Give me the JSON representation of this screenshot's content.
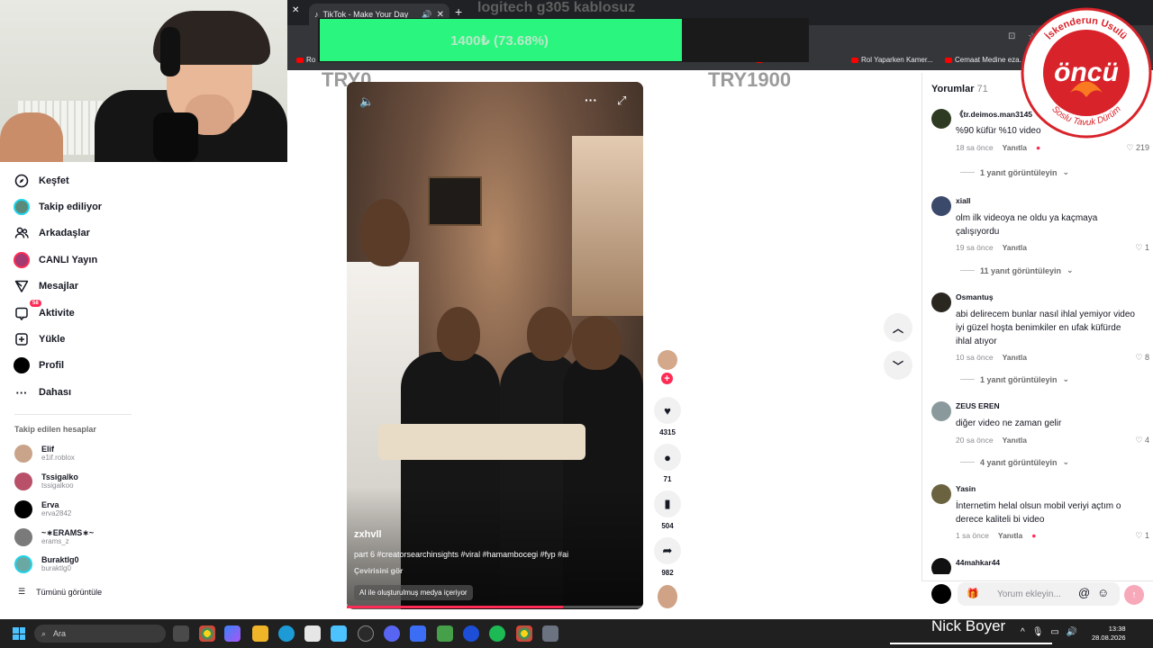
{
  "browser": {
    "tab_title": "TikTok - Make Your Day",
    "tab_close": "✕",
    "window_close": "✕",
    "new_tab": "+",
    "bookmarks": [
      {
        "label": "Ro"
      },
      {
        "label": "s Not Dr..."
      },
      {
        "label": "Rol Yaparken Kamer..."
      },
      {
        "label": "Cemaat Medine eza..."
      }
    ]
  },
  "overlay": {
    "title": "logitech g305 kablosuz",
    "goal_text": "1400₺ (73.68%)",
    "progress_fraction": 0.7368,
    "min_label": "TRY0",
    "max_label": "TRY1900",
    "fill_color": "#2af57e"
  },
  "sidebar": {
    "items": [
      {
        "label": "Keşfet",
        "icon": "compass-icon",
        "glyph": "◎"
      },
      {
        "label": "Takip ediliyor",
        "icon": "following-avatar-icon",
        "glyph": ""
      },
      {
        "label": "Arkadaşlar",
        "icon": "friends-icon",
        "glyph": "👥"
      },
      {
        "label": "CANLI Yayın",
        "icon": "live-icon",
        "glyph": ""
      },
      {
        "label": "Mesajlar",
        "icon": "send-icon",
        "glyph": "▽"
      },
      {
        "label": "Aktivite",
        "icon": "activity-icon",
        "glyph": "▢",
        "badge": "58"
      },
      {
        "label": "Yükle",
        "icon": "upload-icon",
        "glyph": "⊞"
      },
      {
        "label": "Profil",
        "icon": "profile-icon",
        "glyph": ""
      },
      {
        "label": "Dahası",
        "icon": "more-icon",
        "glyph": "···"
      }
    ],
    "following_header": "Takip edilen hesaplar",
    "accounts": [
      {
        "name": "Elif",
        "handle": "e1if.roblox",
        "color": "#c9a48a"
      },
      {
        "name": "Tssigalko",
        "handle": "tssigalkoo",
        "color": "#b8506a"
      },
      {
        "name": "Erva",
        "handle": "erva2842",
        "color": "#000000"
      },
      {
        "name": "~∗ERAMS∗~",
        "handle": "erams_z",
        "color": "#7a7a7a"
      },
      {
        "name": "Buraktlg0",
        "handle": "buraktlg0",
        "color": "#6aa8a4"
      }
    ],
    "see_all": "Tümünü görüntüle"
  },
  "video": {
    "author": "zxhvll",
    "description": "part 6 #creatorsearchinsights #viral #hamambocegi #fyp #ai",
    "translate": "Çevirisini gör",
    "ai_label": "AI ile oluşturulmuş medya içeriyor",
    "progress_fraction": 0.73
  },
  "actions": {
    "likes": "4315",
    "comments": "71",
    "saves": "504",
    "shares": "982"
  },
  "comments_panel": {
    "header": "Yorumlar",
    "count": "71",
    "input_placeholder": "Yorum ekleyin...",
    "comments": [
      {
        "user": "《tr.deimos.man3145",
        "text": "%90 küfür %10 video",
        "time": "18 sa önce",
        "reply": "Yanıtla",
        "likes": "219",
        "replies": "1 yanıt görüntüleyin",
        "avatar_color": "#2e3a22"
      },
      {
        "user": "xiall",
        "text": "olm ilk videoya ne oldu ya kaçmaya çalışıyordu",
        "time": "19 sa önce",
        "reply": "Yanıtla",
        "likes": "1",
        "replies": "11 yanıt görüntüleyin",
        "avatar_color": "#3b4a6b"
      },
      {
        "user": "Osmantuş",
        "text": "abi delirecem bunlar nasıl ihlal yemiyor video iyi güzel hoşta benimkiler en ufak küfürde ihlal atıyor",
        "time": "10 sa önce",
        "reply": "Yanıtla",
        "likes": "8",
        "replies": "1 yanıt görüntüleyin",
        "avatar_color": "#2a2620"
      },
      {
        "user": "ZEUS EREN",
        "text": "diğer video ne zaman gelir",
        "time": "20 sa önce",
        "reply": "Yanıtla",
        "likes": "4",
        "replies": "4 yanıt görüntüleyin",
        "avatar_color": "#8a9a9c"
      },
      {
        "user": "Yasin",
        "text": "İnternetim helal olsun mobil veriyi açtım o derece kaliteli bi video",
        "time": "1 sa önce",
        "reply": "Yanıtla",
        "likes": "1",
        "replies": "",
        "avatar_color": "#6b6240"
      },
      {
        "user": "44mahkar44",
        "text": "",
        "time": "",
        "reply": "",
        "likes": "",
        "replies": "",
        "avatar_color": "#111111"
      }
    ]
  },
  "logo": {
    "brand": "öncü",
    "top_text": "İskenderun Usulü",
    "bottom_text": "Soslu Tavuk Dürüm",
    "color": "#d8232a"
  },
  "taskbar": {
    "search_placeholder": "Ara",
    "time": "13:38",
    "date": "28.08.2026"
  },
  "streamer": {
    "name": "Nick Boyer"
  }
}
